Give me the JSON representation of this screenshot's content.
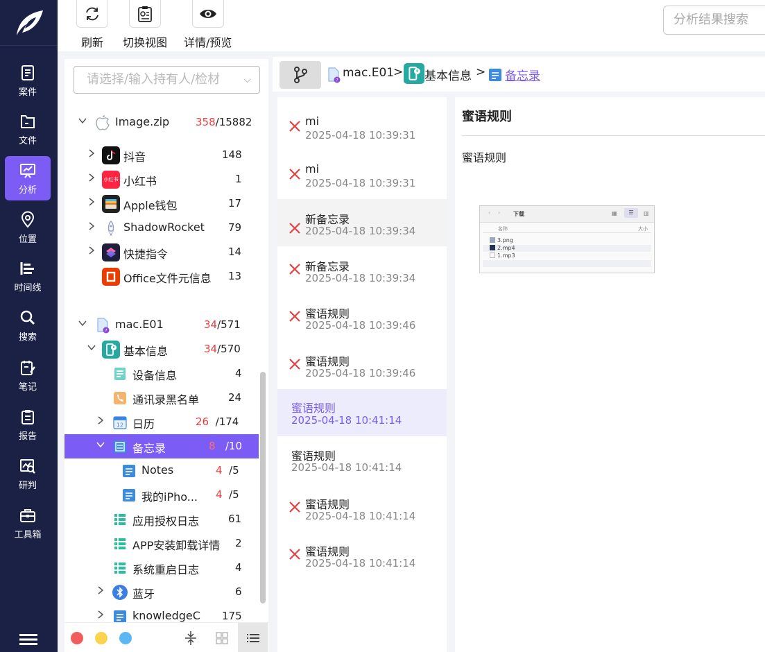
{
  "nav": {
    "items": [
      {
        "label": "案件",
        "icon": "case-icon"
      },
      {
        "label": "文件",
        "icon": "file-icon"
      },
      {
        "label": "分析",
        "icon": "analysis-icon",
        "active": true
      },
      {
        "label": "位置",
        "icon": "location-icon"
      },
      {
        "label": "时间线",
        "icon": "timeline-icon"
      },
      {
        "label": "搜索",
        "icon": "search-icon"
      },
      {
        "label": "笔记",
        "icon": "note-icon"
      },
      {
        "label": "报告",
        "icon": "report-icon"
      },
      {
        "label": "研判",
        "icon": "judge-icon"
      },
      {
        "label": "工具箱",
        "icon": "toolbox-icon"
      }
    ]
  },
  "toolbar": {
    "refresh_label": "刷新",
    "switch_view_label": "切换视图",
    "detail_preview_label": "详情/预览",
    "search_placeholder": "分析结果搜索"
  },
  "tree": {
    "select_placeholder": "请选择/输入持有人/检材",
    "rows": [
      {
        "label": "Image.zip",
        "hl": "358",
        "rest": "/15882"
      },
      {
        "label": "抖音",
        "count": "148"
      },
      {
        "label": "小红书",
        "count": "1",
        "icon_text": "小红书"
      },
      {
        "label": "Apple钱包",
        "count": "17"
      },
      {
        "label": "ShadowRocket",
        "count": "79"
      },
      {
        "label": "快捷指令",
        "count": "14"
      },
      {
        "label": "Office文件元信息",
        "count": "13"
      },
      {
        "label": "mac.E01",
        "hl": "34",
        "rest": "/571"
      },
      {
        "label": "基本信息",
        "hl": "34",
        "rest": "/570"
      },
      {
        "label": "设备信息",
        "count": "4"
      },
      {
        "label": "通讯录黑名单",
        "count": "24"
      },
      {
        "label": "日历",
        "hl": "26",
        "rest": "/174",
        "icon_text": "12"
      },
      {
        "label": "备忘录",
        "hl": "8",
        "rest": "/10"
      },
      {
        "label": "Notes",
        "hl": "4",
        "rest": "/5"
      },
      {
        "label": "我的iPho...",
        "hl": "4",
        "rest": "/5"
      },
      {
        "label": "应用授权日志",
        "count": "61"
      },
      {
        "label": "APP安装卸载详情",
        "count": "2"
      },
      {
        "label": "系统重启日志",
        "count": "4"
      },
      {
        "label": "蓝牙",
        "count": "6"
      },
      {
        "label": "knowledgeC",
        "count": "175"
      }
    ]
  },
  "breadcrumb": {
    "items": [
      "mac.E01",
      "基本信息",
      "备忘录"
    ],
    "sep": ">"
  },
  "list": {
    "items": [
      {
        "title": "mi",
        "date": "2025-04-18 10:39:31",
        "deleted": true
      },
      {
        "title": "mi",
        "date": "2025-04-18 10:39:31",
        "deleted": true
      },
      {
        "title": "新备忘录",
        "date": "2025-04-18 10:39:34",
        "deleted": true
      },
      {
        "title": "新备忘录",
        "date": "2025-04-18 10:39:34",
        "deleted": true
      },
      {
        "title": "蜜语规则",
        "date": "2025-04-18 10:39:46",
        "deleted": true
      },
      {
        "title": "蜜语规则",
        "date": "2025-04-18 10:39:46",
        "deleted": true
      },
      {
        "title": "蜜语规则",
        "date": "2025-04-18 10:41:14",
        "deleted": false,
        "selected": true
      },
      {
        "title": "蜜语规则",
        "date": "2025-04-18 10:41:14",
        "deleted": false
      },
      {
        "title": "蜜语规则",
        "date": "2025-04-18 10:41:14",
        "deleted": true
      },
      {
        "title": "蜜语规则",
        "date": "2025-04-18 10:41:14",
        "deleted": true
      }
    ]
  },
  "detail": {
    "title": "蜜语规则",
    "body": "蜜语规则",
    "thumb": {
      "folder": "下载",
      "col_name": "名称",
      "col_size": "大小",
      "files": [
        "3.png",
        "2.mp4",
        "1.mp3"
      ]
    }
  },
  "colors": {
    "accent": "#7b5cf5",
    "nav_bg": "#1a2145",
    "deleted": "#e84040"
  }
}
